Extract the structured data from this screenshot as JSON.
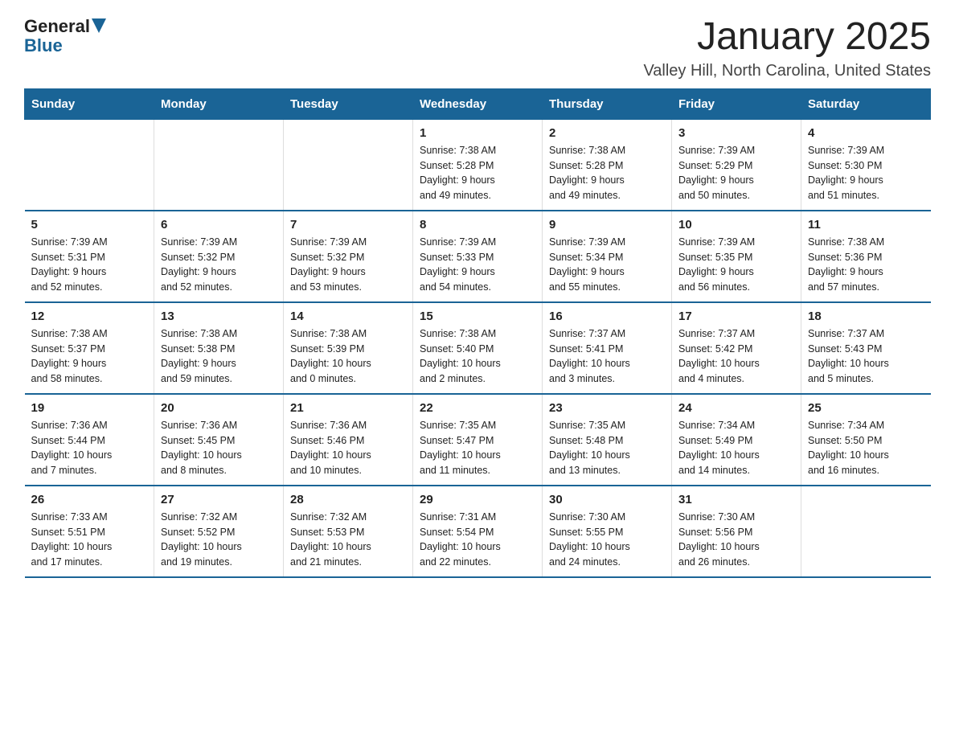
{
  "logo": {
    "general": "General",
    "arrow_color": "#1a6496",
    "blue": "Blue"
  },
  "header": {
    "title": "January 2025",
    "subtitle": "Valley Hill, North Carolina, United States"
  },
  "weekdays": [
    "Sunday",
    "Monday",
    "Tuesday",
    "Wednesday",
    "Thursday",
    "Friday",
    "Saturday"
  ],
  "weeks": [
    [
      {
        "day": "",
        "info": ""
      },
      {
        "day": "",
        "info": ""
      },
      {
        "day": "",
        "info": ""
      },
      {
        "day": "1",
        "info": "Sunrise: 7:38 AM\nSunset: 5:28 PM\nDaylight: 9 hours\nand 49 minutes."
      },
      {
        "day": "2",
        "info": "Sunrise: 7:38 AM\nSunset: 5:28 PM\nDaylight: 9 hours\nand 49 minutes."
      },
      {
        "day": "3",
        "info": "Sunrise: 7:39 AM\nSunset: 5:29 PM\nDaylight: 9 hours\nand 50 minutes."
      },
      {
        "day": "4",
        "info": "Sunrise: 7:39 AM\nSunset: 5:30 PM\nDaylight: 9 hours\nand 51 minutes."
      }
    ],
    [
      {
        "day": "5",
        "info": "Sunrise: 7:39 AM\nSunset: 5:31 PM\nDaylight: 9 hours\nand 52 minutes."
      },
      {
        "day": "6",
        "info": "Sunrise: 7:39 AM\nSunset: 5:32 PM\nDaylight: 9 hours\nand 52 minutes."
      },
      {
        "day": "7",
        "info": "Sunrise: 7:39 AM\nSunset: 5:32 PM\nDaylight: 9 hours\nand 53 minutes."
      },
      {
        "day": "8",
        "info": "Sunrise: 7:39 AM\nSunset: 5:33 PM\nDaylight: 9 hours\nand 54 minutes."
      },
      {
        "day": "9",
        "info": "Sunrise: 7:39 AM\nSunset: 5:34 PM\nDaylight: 9 hours\nand 55 minutes."
      },
      {
        "day": "10",
        "info": "Sunrise: 7:39 AM\nSunset: 5:35 PM\nDaylight: 9 hours\nand 56 minutes."
      },
      {
        "day": "11",
        "info": "Sunrise: 7:38 AM\nSunset: 5:36 PM\nDaylight: 9 hours\nand 57 minutes."
      }
    ],
    [
      {
        "day": "12",
        "info": "Sunrise: 7:38 AM\nSunset: 5:37 PM\nDaylight: 9 hours\nand 58 minutes."
      },
      {
        "day": "13",
        "info": "Sunrise: 7:38 AM\nSunset: 5:38 PM\nDaylight: 9 hours\nand 59 minutes."
      },
      {
        "day": "14",
        "info": "Sunrise: 7:38 AM\nSunset: 5:39 PM\nDaylight: 10 hours\nand 0 minutes."
      },
      {
        "day": "15",
        "info": "Sunrise: 7:38 AM\nSunset: 5:40 PM\nDaylight: 10 hours\nand 2 minutes."
      },
      {
        "day": "16",
        "info": "Sunrise: 7:37 AM\nSunset: 5:41 PM\nDaylight: 10 hours\nand 3 minutes."
      },
      {
        "day": "17",
        "info": "Sunrise: 7:37 AM\nSunset: 5:42 PM\nDaylight: 10 hours\nand 4 minutes."
      },
      {
        "day": "18",
        "info": "Sunrise: 7:37 AM\nSunset: 5:43 PM\nDaylight: 10 hours\nand 5 minutes."
      }
    ],
    [
      {
        "day": "19",
        "info": "Sunrise: 7:36 AM\nSunset: 5:44 PM\nDaylight: 10 hours\nand 7 minutes."
      },
      {
        "day": "20",
        "info": "Sunrise: 7:36 AM\nSunset: 5:45 PM\nDaylight: 10 hours\nand 8 minutes."
      },
      {
        "day": "21",
        "info": "Sunrise: 7:36 AM\nSunset: 5:46 PM\nDaylight: 10 hours\nand 10 minutes."
      },
      {
        "day": "22",
        "info": "Sunrise: 7:35 AM\nSunset: 5:47 PM\nDaylight: 10 hours\nand 11 minutes."
      },
      {
        "day": "23",
        "info": "Sunrise: 7:35 AM\nSunset: 5:48 PM\nDaylight: 10 hours\nand 13 minutes."
      },
      {
        "day": "24",
        "info": "Sunrise: 7:34 AM\nSunset: 5:49 PM\nDaylight: 10 hours\nand 14 minutes."
      },
      {
        "day": "25",
        "info": "Sunrise: 7:34 AM\nSunset: 5:50 PM\nDaylight: 10 hours\nand 16 minutes."
      }
    ],
    [
      {
        "day": "26",
        "info": "Sunrise: 7:33 AM\nSunset: 5:51 PM\nDaylight: 10 hours\nand 17 minutes."
      },
      {
        "day": "27",
        "info": "Sunrise: 7:32 AM\nSunset: 5:52 PM\nDaylight: 10 hours\nand 19 minutes."
      },
      {
        "day": "28",
        "info": "Sunrise: 7:32 AM\nSunset: 5:53 PM\nDaylight: 10 hours\nand 21 minutes."
      },
      {
        "day": "29",
        "info": "Sunrise: 7:31 AM\nSunset: 5:54 PM\nDaylight: 10 hours\nand 22 minutes."
      },
      {
        "day": "30",
        "info": "Sunrise: 7:30 AM\nSunset: 5:55 PM\nDaylight: 10 hours\nand 24 minutes."
      },
      {
        "day": "31",
        "info": "Sunrise: 7:30 AM\nSunset: 5:56 PM\nDaylight: 10 hours\nand 26 minutes."
      },
      {
        "day": "",
        "info": ""
      }
    ]
  ]
}
